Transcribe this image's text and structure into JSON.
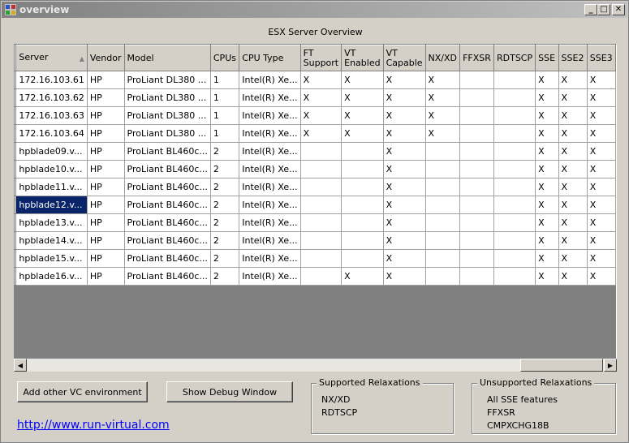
{
  "window": {
    "title": "overview",
    "controls": {
      "minimize": "_",
      "maximize": "□",
      "close": "✕"
    }
  },
  "caption": "ESX Server Overview",
  "grid": {
    "columns": [
      "Server",
      "Vendor",
      "Model",
      "CPUs",
      "CPU Type",
      "FT Support",
      "VT Enabled",
      "VT Capable",
      "NX/XD",
      "FFXSR",
      "RDTSCP",
      "SSE",
      "SSE2",
      "SSE3"
    ],
    "sorted_column": "Server",
    "selected_row": 7,
    "rows": [
      [
        "172.16.103.61",
        "HP",
        "ProLiant DL380 ...",
        "1",
        "Intel(R) Xe...",
        "X",
        "X",
        "X",
        "X",
        "",
        "",
        "X",
        "X",
        "X"
      ],
      [
        "172.16.103.62",
        "HP",
        "ProLiant DL380 ...",
        "1",
        "Intel(R) Xe...",
        "X",
        "X",
        "X",
        "X",
        "",
        "",
        "X",
        "X",
        "X"
      ],
      [
        "172.16.103.63",
        "HP",
        "ProLiant DL380 ...",
        "1",
        "Intel(R) Xe...",
        "X",
        "X",
        "X",
        "X",
        "",
        "",
        "X",
        "X",
        "X"
      ],
      [
        "172.16.103.64",
        "HP",
        "ProLiant DL380 ...",
        "1",
        "Intel(R) Xe...",
        "X",
        "X",
        "X",
        "X",
        "",
        "",
        "X",
        "X",
        "X"
      ],
      [
        "hpblade09.v...",
        "HP",
        "ProLiant BL460c...",
        "2",
        "Intel(R) Xe...",
        "",
        "",
        "X",
        "",
        "",
        "",
        "X",
        "X",
        "X"
      ],
      [
        "hpblade10.v...",
        "HP",
        "ProLiant BL460c...",
        "2",
        "Intel(R) Xe...",
        "",
        "",
        "X",
        "",
        "",
        "",
        "X",
        "X",
        "X"
      ],
      [
        "hpblade11.v...",
        "HP",
        "ProLiant BL460c...",
        "2",
        "Intel(R) Xe...",
        "",
        "",
        "X",
        "",
        "",
        "",
        "X",
        "X",
        "X"
      ],
      [
        "hpblade12.v...",
        "HP",
        "ProLiant BL460c...",
        "2",
        "Intel(R) Xe...",
        "",
        "",
        "X",
        "",
        "",
        "",
        "X",
        "X",
        "X"
      ],
      [
        "hpblade13.v...",
        "HP",
        "ProLiant BL460c...",
        "2",
        "Intel(R) Xe...",
        "",
        "",
        "X",
        "",
        "",
        "",
        "X",
        "X",
        "X"
      ],
      [
        "hpblade14.v...",
        "HP",
        "ProLiant BL460c...",
        "2",
        "Intel(R) Xe...",
        "",
        "",
        "X",
        "",
        "",
        "",
        "X",
        "X",
        "X"
      ],
      [
        "hpblade15.v...",
        "HP",
        "ProLiant BL460c...",
        "2",
        "Intel(R) Xe...",
        "",
        "",
        "X",
        "",
        "",
        "",
        "X",
        "X",
        "X"
      ],
      [
        "hpblade16.v...",
        "HP",
        "ProLiant BL460c...",
        "2",
        "Intel(R) Xe...",
        "",
        "X",
        "X",
        "",
        "",
        "",
        "X",
        "X",
        "X"
      ]
    ]
  },
  "buttons": {
    "add_vc": "Add other VC environment",
    "debug": "Show Debug Window"
  },
  "supported": {
    "title": "Supported Relaxations",
    "items": [
      "NX/XD",
      "RDTSCP"
    ]
  },
  "unsupported": {
    "title": "Unsupported Relaxations",
    "items": [
      "All SSE features",
      "FFXSR",
      "CMPXCHG18B"
    ]
  },
  "link": "http://www.run-virtual.com",
  "colors": {
    "selection": "#0a246a",
    "link": "#0000ff"
  }
}
